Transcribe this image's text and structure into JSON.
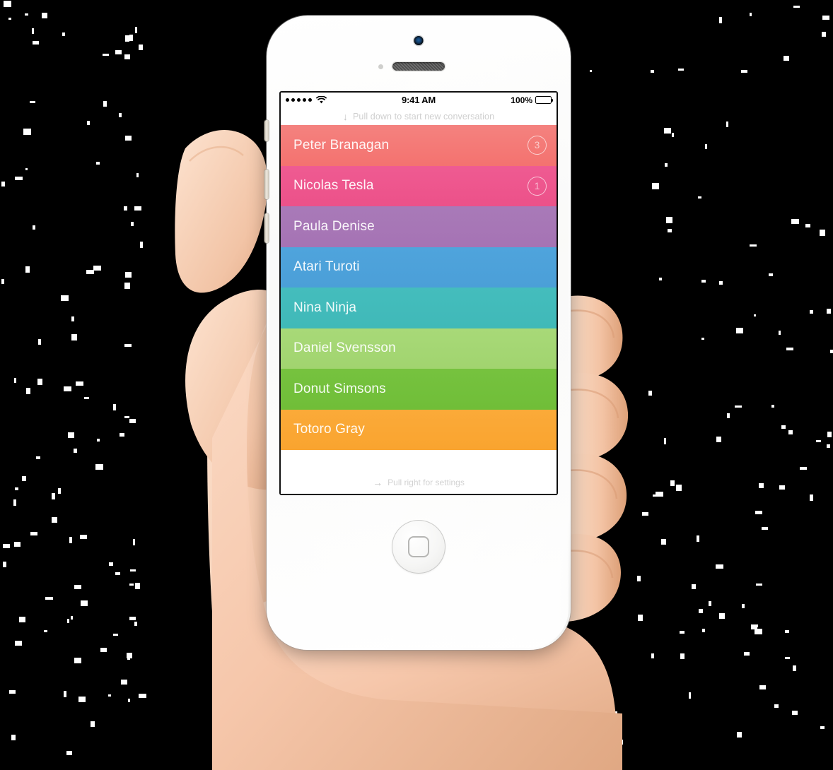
{
  "scene": {
    "background_color": "#000000",
    "description": "hand-holding-white-smartphone"
  },
  "device": {
    "name": "white-smartphone",
    "body_color": "#ffffff",
    "hardware": {
      "front_camera": "camera-icon",
      "proximity_sensor": "proximity-sensor-icon",
      "earpiece_speaker": "speaker-grille-icon",
      "home_button": "home-button-icon",
      "side_buttons": [
        "silent-switch",
        "volume-up-button",
        "volume-down-button"
      ]
    }
  },
  "status_bar": {
    "signal_dots": 5,
    "wifi": "wifi-icon",
    "time": "9:41 AM",
    "battery_percent": "100%",
    "battery_icon": "battery-full-icon"
  },
  "header_hint": {
    "arrow": "↓",
    "label": "Pull down to start new conversation",
    "color": "#cfcfcf"
  },
  "footer_hint": {
    "arrow": "→",
    "label": "Pull right for settings",
    "color": "#d2d2d2"
  },
  "conversations": [
    {
      "name": "Peter Branagan",
      "badge": "3",
      "color_top": "#f4827f",
      "color_bottom": "#f4726f"
    },
    {
      "name": "Nicolas Tesla",
      "badge": "1",
      "color_top": "#ef5b92",
      "color_bottom": "#ec5189"
    },
    {
      "name": "Paula Denise",
      "badge": "",
      "color_top": "#a87ab8",
      "color_bottom": "#a673b4"
    },
    {
      "name": "Atari Turoti",
      "badge": "",
      "color_top": "#4fa4dc",
      "color_bottom": "#4b9fd8"
    },
    {
      "name": "Nina Ninja",
      "badge": "",
      "color_top": "#44bdbd",
      "color_bottom": "#40b9b8"
    },
    {
      "name": "Daniel Svensson",
      "badge": "",
      "color_top": "#a8d978",
      "color_bottom": "#a1d46f"
    },
    {
      "name": "Donut Simsons",
      "badge": "",
      "color_top": "#76c23f",
      "color_bottom": "#70be38"
    },
    {
      "name": "Totoro Gray",
      "badge": "",
      "color_top": "#fbaa39",
      "color_bottom": "#f9a42f"
    }
  ],
  "list_style": {
    "name_color": "rgba(255,255,255,0.93)",
    "badge_border_color": "rgba(255,255,255,0.65)",
    "empty_area_color": "#ffffff"
  }
}
